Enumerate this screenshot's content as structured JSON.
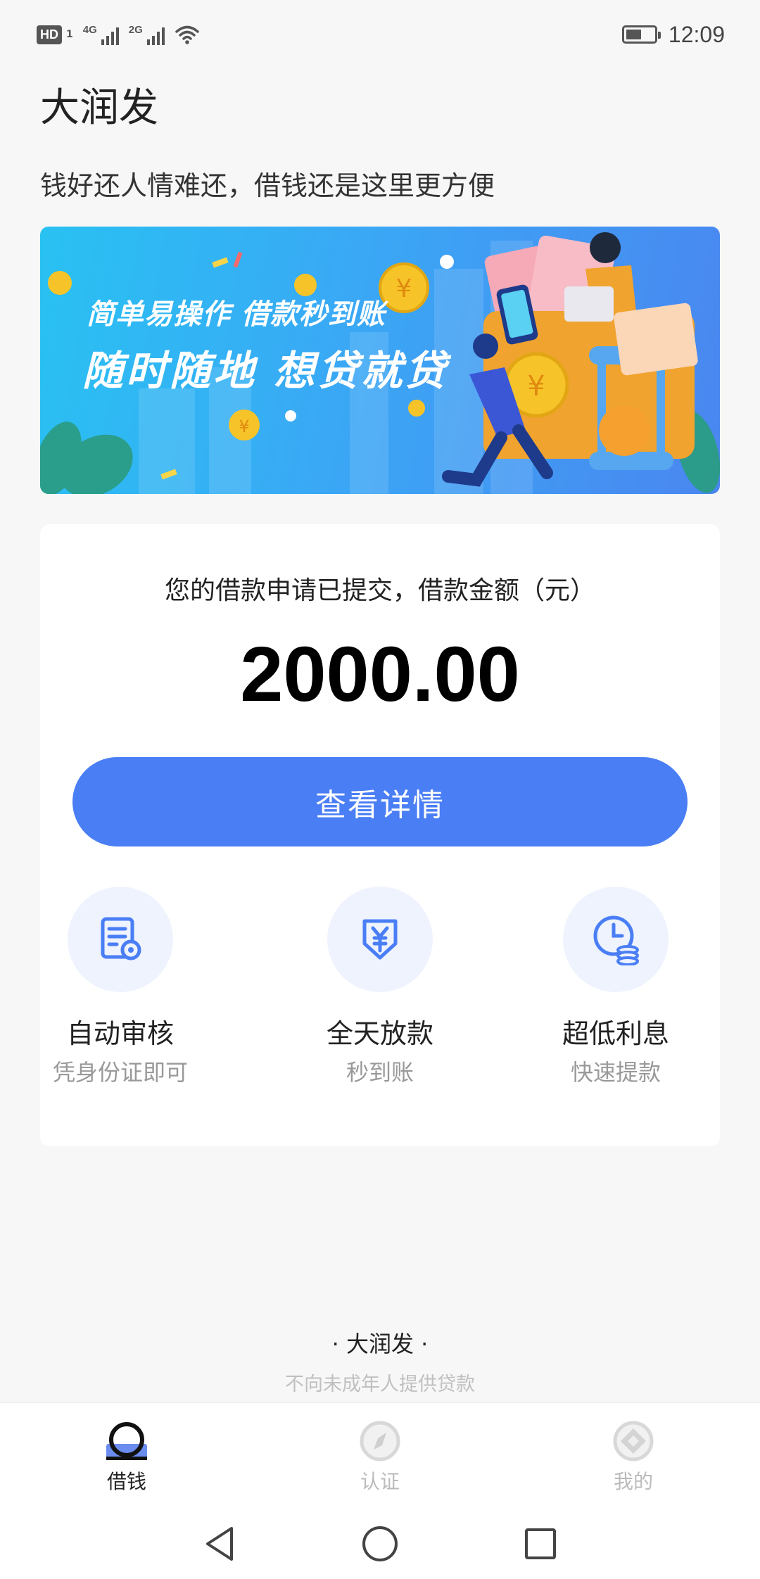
{
  "status_bar": {
    "hd_label": "HD",
    "sim_index": "1",
    "network_1": "4G",
    "network_2": "2G",
    "time": "12:09",
    "icons": [
      "hd-icon",
      "signal-icon",
      "wifi-icon",
      "battery-icon"
    ]
  },
  "app": {
    "title": "大润发",
    "slogan": "钱好还人情难还，借钱还是这里更方便"
  },
  "banner": {
    "line1": "简单易操作 借款秒到账",
    "line2": "随时随地 想贷就贷",
    "coin_symbol": "¥"
  },
  "loan_card": {
    "message": "您的借款申请已提交，借款金额（元）",
    "amount": "2000.00",
    "button_label": "查看详情"
  },
  "features": [
    {
      "icon": "document-search-icon",
      "title": "自动审核",
      "subtitle": "凭身份证即可"
    },
    {
      "icon": "yuan-download-icon",
      "title": "全天放款",
      "subtitle": "秒到账"
    },
    {
      "icon": "clock-coins-icon",
      "title": "超低利息",
      "subtitle": "快速提款"
    }
  ],
  "footer": {
    "brand": "· 大润发 ·",
    "notice": "不向未成年人提供贷款"
  },
  "tabs": [
    {
      "label": "借钱",
      "icon": "borrow-icon",
      "active": true
    },
    {
      "label": "认证",
      "icon": "compass-icon",
      "active": false
    },
    {
      "label": "我的",
      "icon": "profile-icon",
      "active": false
    }
  ],
  "system_nav": {
    "buttons": [
      "back-icon",
      "home-icon",
      "recents-icon"
    ]
  },
  "colors": {
    "accent": "#4a7ef5",
    "icon_bg": "#eef3fe",
    "muted": "#999999"
  }
}
